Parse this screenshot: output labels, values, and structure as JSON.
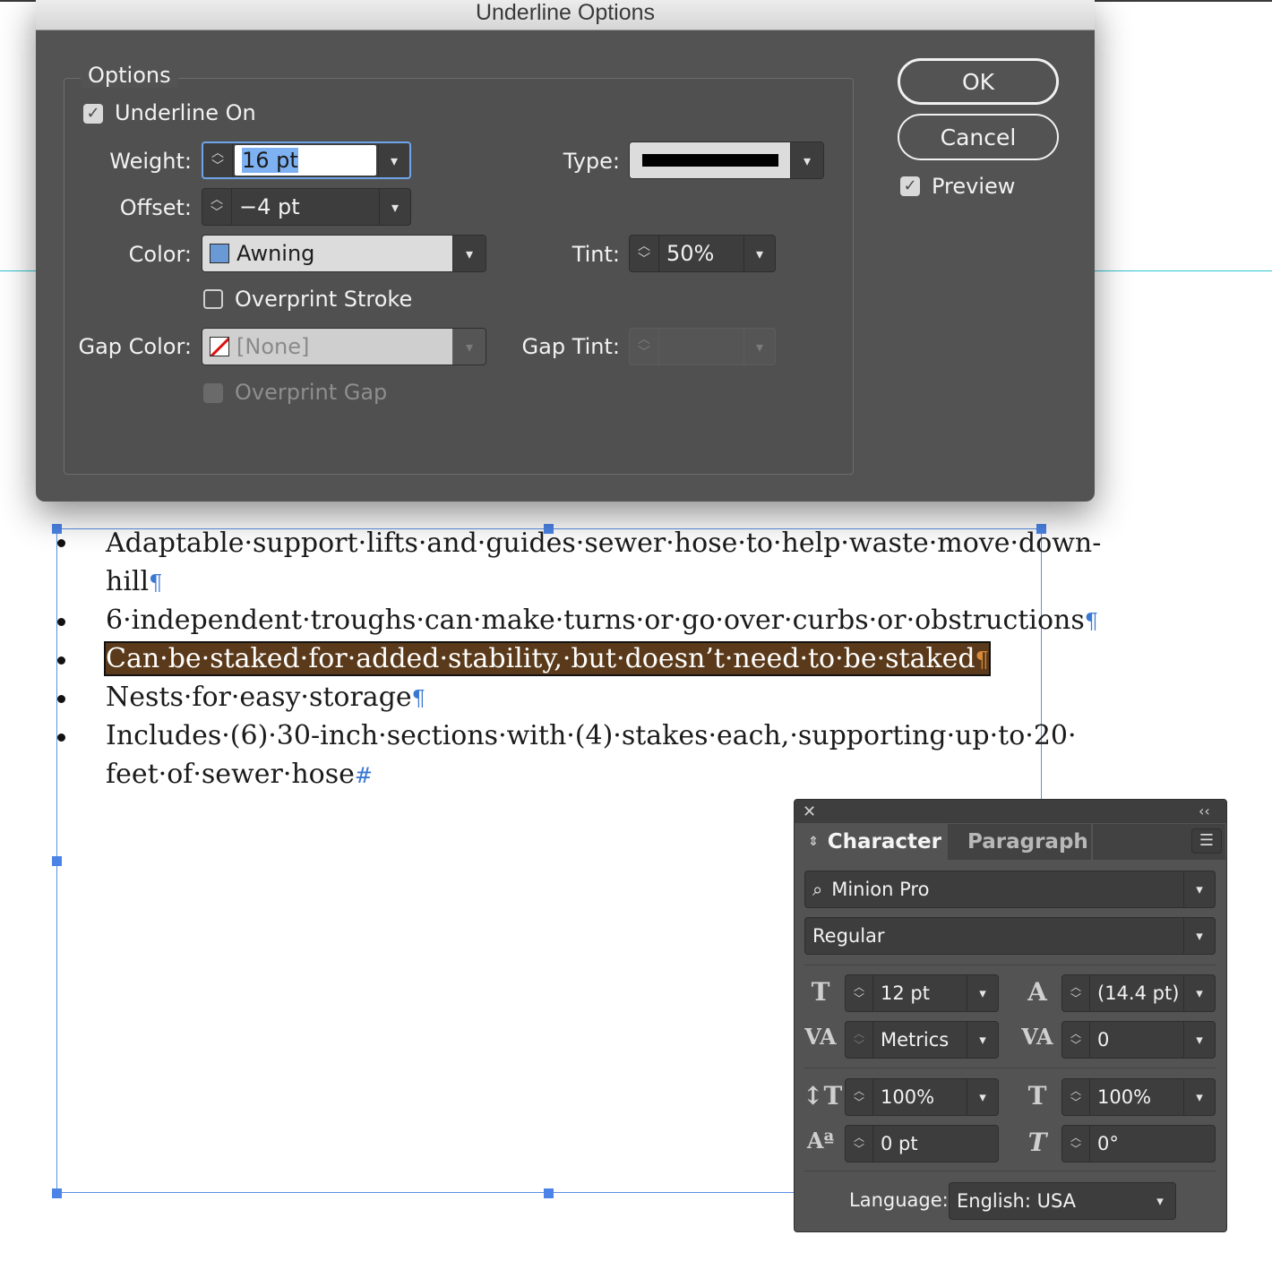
{
  "dialog": {
    "title": "Underline Options",
    "group_label": "Options",
    "underline_on": {
      "label": "Underline On",
      "checked": true
    },
    "weight": {
      "label": "Weight:",
      "value": "16 pt"
    },
    "offset": {
      "label": "Offset:",
      "value": "−4 pt"
    },
    "color": {
      "label": "Color:",
      "value": "Awning",
      "swatch": "#6a9ad6"
    },
    "overprint_stroke": {
      "label": "Overprint Stroke",
      "checked": false
    },
    "gap_color": {
      "label": "Gap Color:",
      "value": "[None]"
    },
    "overprint_gap": {
      "label": "Overprint Gap",
      "checked": false,
      "disabled": true
    },
    "type": {
      "label": "Type:"
    },
    "tint": {
      "label": "Tint:",
      "value": "50%"
    },
    "gap_tint": {
      "label": "Gap Tint:",
      "value": ""
    },
    "buttons": {
      "ok": "OK",
      "cancel": "Cancel"
    },
    "preview": {
      "label": "Preview",
      "checked": true
    }
  },
  "document": {
    "lines": [
      "Adaptable·support·lifts·and·guides·sewer·hose·to·help·waste·move·down-",
      "hill",
      "6·independent·troughs·can·make·turns·or·go·over·curbs·or·obstructions",
      "Can·be·staked·for·added·stability,·but·doesn’t·need·to·be·staked",
      "Nests·for·easy·storage",
      "Includes·(6)·30-inch·sections·with·(4)·stakes·each,·supporting·up·to·20·",
      "feet·of·sewer·hose"
    ],
    "pilcrow": "¶",
    "end_mark": "#"
  },
  "panel": {
    "tabs": {
      "character": "Character",
      "paragraph": "Paragraph"
    },
    "font_family": "Minion Pro",
    "font_style": "Regular",
    "font_size": "12 pt",
    "leading": "(14.4 pt)",
    "kerning": "Metrics",
    "tracking": "0",
    "vertical_scale": "100%",
    "horizontal_scale": "100%",
    "baseline_shift": "0 pt",
    "skew": "0°",
    "language_label": "Language:",
    "language": "English: USA"
  }
}
